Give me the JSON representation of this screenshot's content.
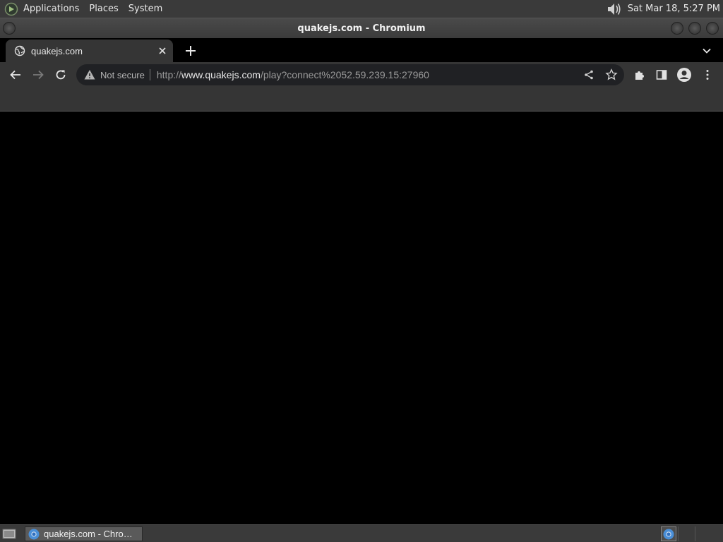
{
  "top_panel": {
    "menus": [
      "Applications",
      "Places",
      "System"
    ],
    "clock": "Sat Mar 18,  5:27 PM",
    "volume_icon": "speaker-volume-icon"
  },
  "window": {
    "title": "quakejs.com - Chromium"
  },
  "browser": {
    "tab": {
      "title": "quakejs.com",
      "favicon": "globe-icon"
    },
    "security": "Not secure",
    "url": {
      "scheme": "http://",
      "host": "www.quakejs.com",
      "path": "/play?connect%2052.59.239.15:27960"
    },
    "colors": {
      "toolbar": "#353535",
      "omnibox": "#202124",
      "tabstrip": "#000000"
    }
  },
  "taskbar": {
    "task_label": "quakejs.com - Chro…"
  }
}
